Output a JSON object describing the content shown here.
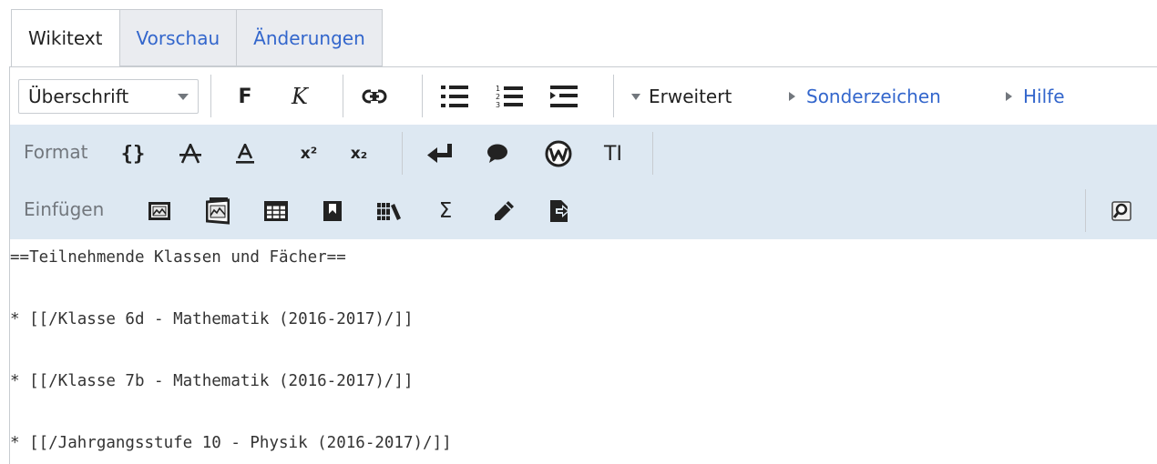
{
  "tabs": [
    {
      "label": "Wikitext",
      "active": true
    },
    {
      "label": "Vorschau",
      "active": false
    },
    {
      "label": "Änderungen",
      "active": false
    }
  ],
  "toolbar": {
    "heading_select": "Überschrift",
    "bold_label": "F",
    "italic_label": "K",
    "advanced_label": "Erweitert",
    "special_chars_label": "Sonderzeichen",
    "help_label": "Hilfe"
  },
  "format_group": {
    "label": "Format",
    "code_label": "{}",
    "superscript_label": "x²",
    "subscript_label": "x₂",
    "ti_label": "TI"
  },
  "insert_group": {
    "label": "Einfügen",
    "sigma_label": "Σ"
  },
  "editor": {
    "lines": [
      "==Teilnehmende Klassen und Fächer==",
      "* [[/Klasse 6d - Mathematik (2016-2017)/]]",
      "* [[/Klasse 7b - Mathematik (2016-2017)/]]",
      "* [[/Jahrgangsstufe 10 - Physik (2016-2017)/]]"
    ]
  },
  "colors": {
    "link": "#3366cc",
    "border": "#c8ccd1",
    "toolbar_group_bg": "#dde8f2",
    "muted_text": "#72777d"
  }
}
